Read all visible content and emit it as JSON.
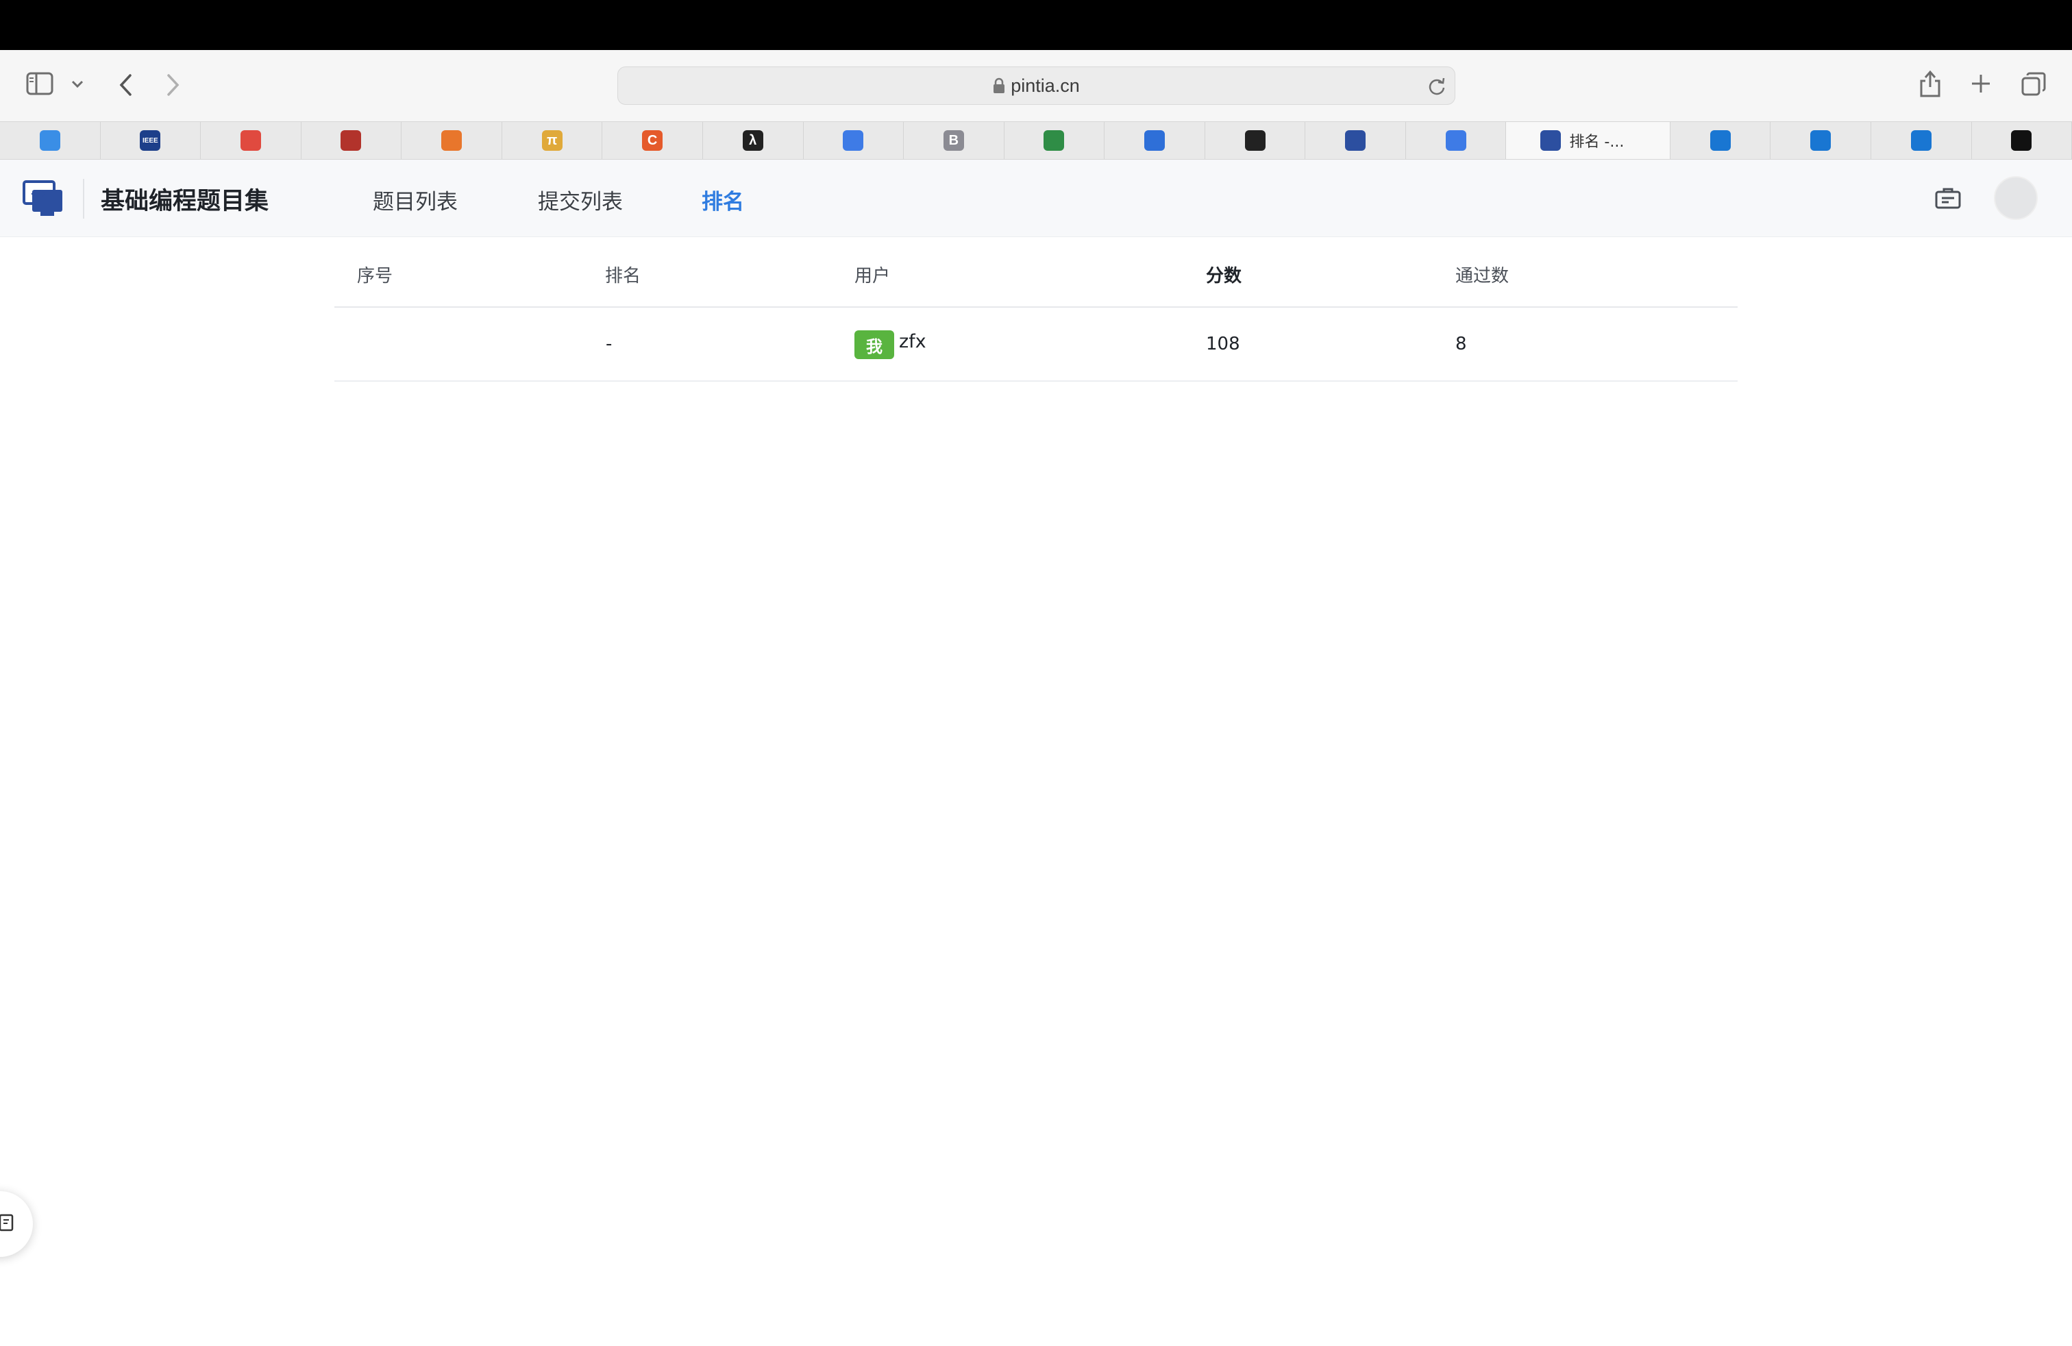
{
  "browser": {
    "url": "pintia.cn",
    "tabs": [
      {
        "icon": "pta-logo-icon",
        "color": "#3a8ee6"
      },
      {
        "icon": "ieee-icon",
        "color": "#1d3f8a",
        "text": "IEEE"
      },
      {
        "icon": "oracle-icon",
        "color": "#e04a3f"
      },
      {
        "icon": "cambridge-shield-icon",
        "color": "#b2332b"
      },
      {
        "icon": "gear-sun-icon",
        "color": "#e8762c"
      },
      {
        "icon": "pi-icon",
        "color": "#e0a93a",
        "text": "π"
      },
      {
        "icon": "c-icon",
        "color": "#e55a2b",
        "text": "C"
      },
      {
        "icon": "lambda-icon",
        "color": "#222222",
        "text": "λ"
      },
      {
        "icon": "square-gradient-icon",
        "color": "#3e7be6"
      },
      {
        "icon": "b-icon",
        "color": "#8b8b93",
        "text": "B"
      },
      {
        "icon": "geeks-icon",
        "color": "#2f8d46"
      },
      {
        "icon": "hexagon-icon",
        "color": "#2e6fd8"
      },
      {
        "icon": "book-icon",
        "color": "#222222"
      },
      {
        "icon": "crest-icon",
        "color": "#2c4fa0"
      },
      {
        "icon": "square-gradient-icon",
        "color": "#3e7be6"
      },
      {
        "icon": "pintia-icon",
        "color": "#2c4fa0",
        "title": "排名 -..."
      },
      {
        "icon": "wave-icon",
        "color": "#1976d2"
      },
      {
        "icon": "wave-icon",
        "color": "#1976d2"
      },
      {
        "icon": "wave-icon",
        "color": "#1976d2"
      },
      {
        "icon": "github-icon",
        "color": "#111111"
      }
    ]
  },
  "header": {
    "title": "基础编程题目集",
    "nav": [
      "题目列表",
      "提交列表",
      "排名"
    ],
    "active_nav": "排名",
    "accent_color": "#2f7ce0"
  },
  "table": {
    "columns": [
      "序号",
      "排名",
      "用户",
      "分数",
      "通过数"
    ],
    "rows": [
      {
        "index": "",
        "rank": "-",
        "me_badge": "我",
        "user": "zfx",
        "score": "108",
        "passed": "8"
      }
    ]
  }
}
